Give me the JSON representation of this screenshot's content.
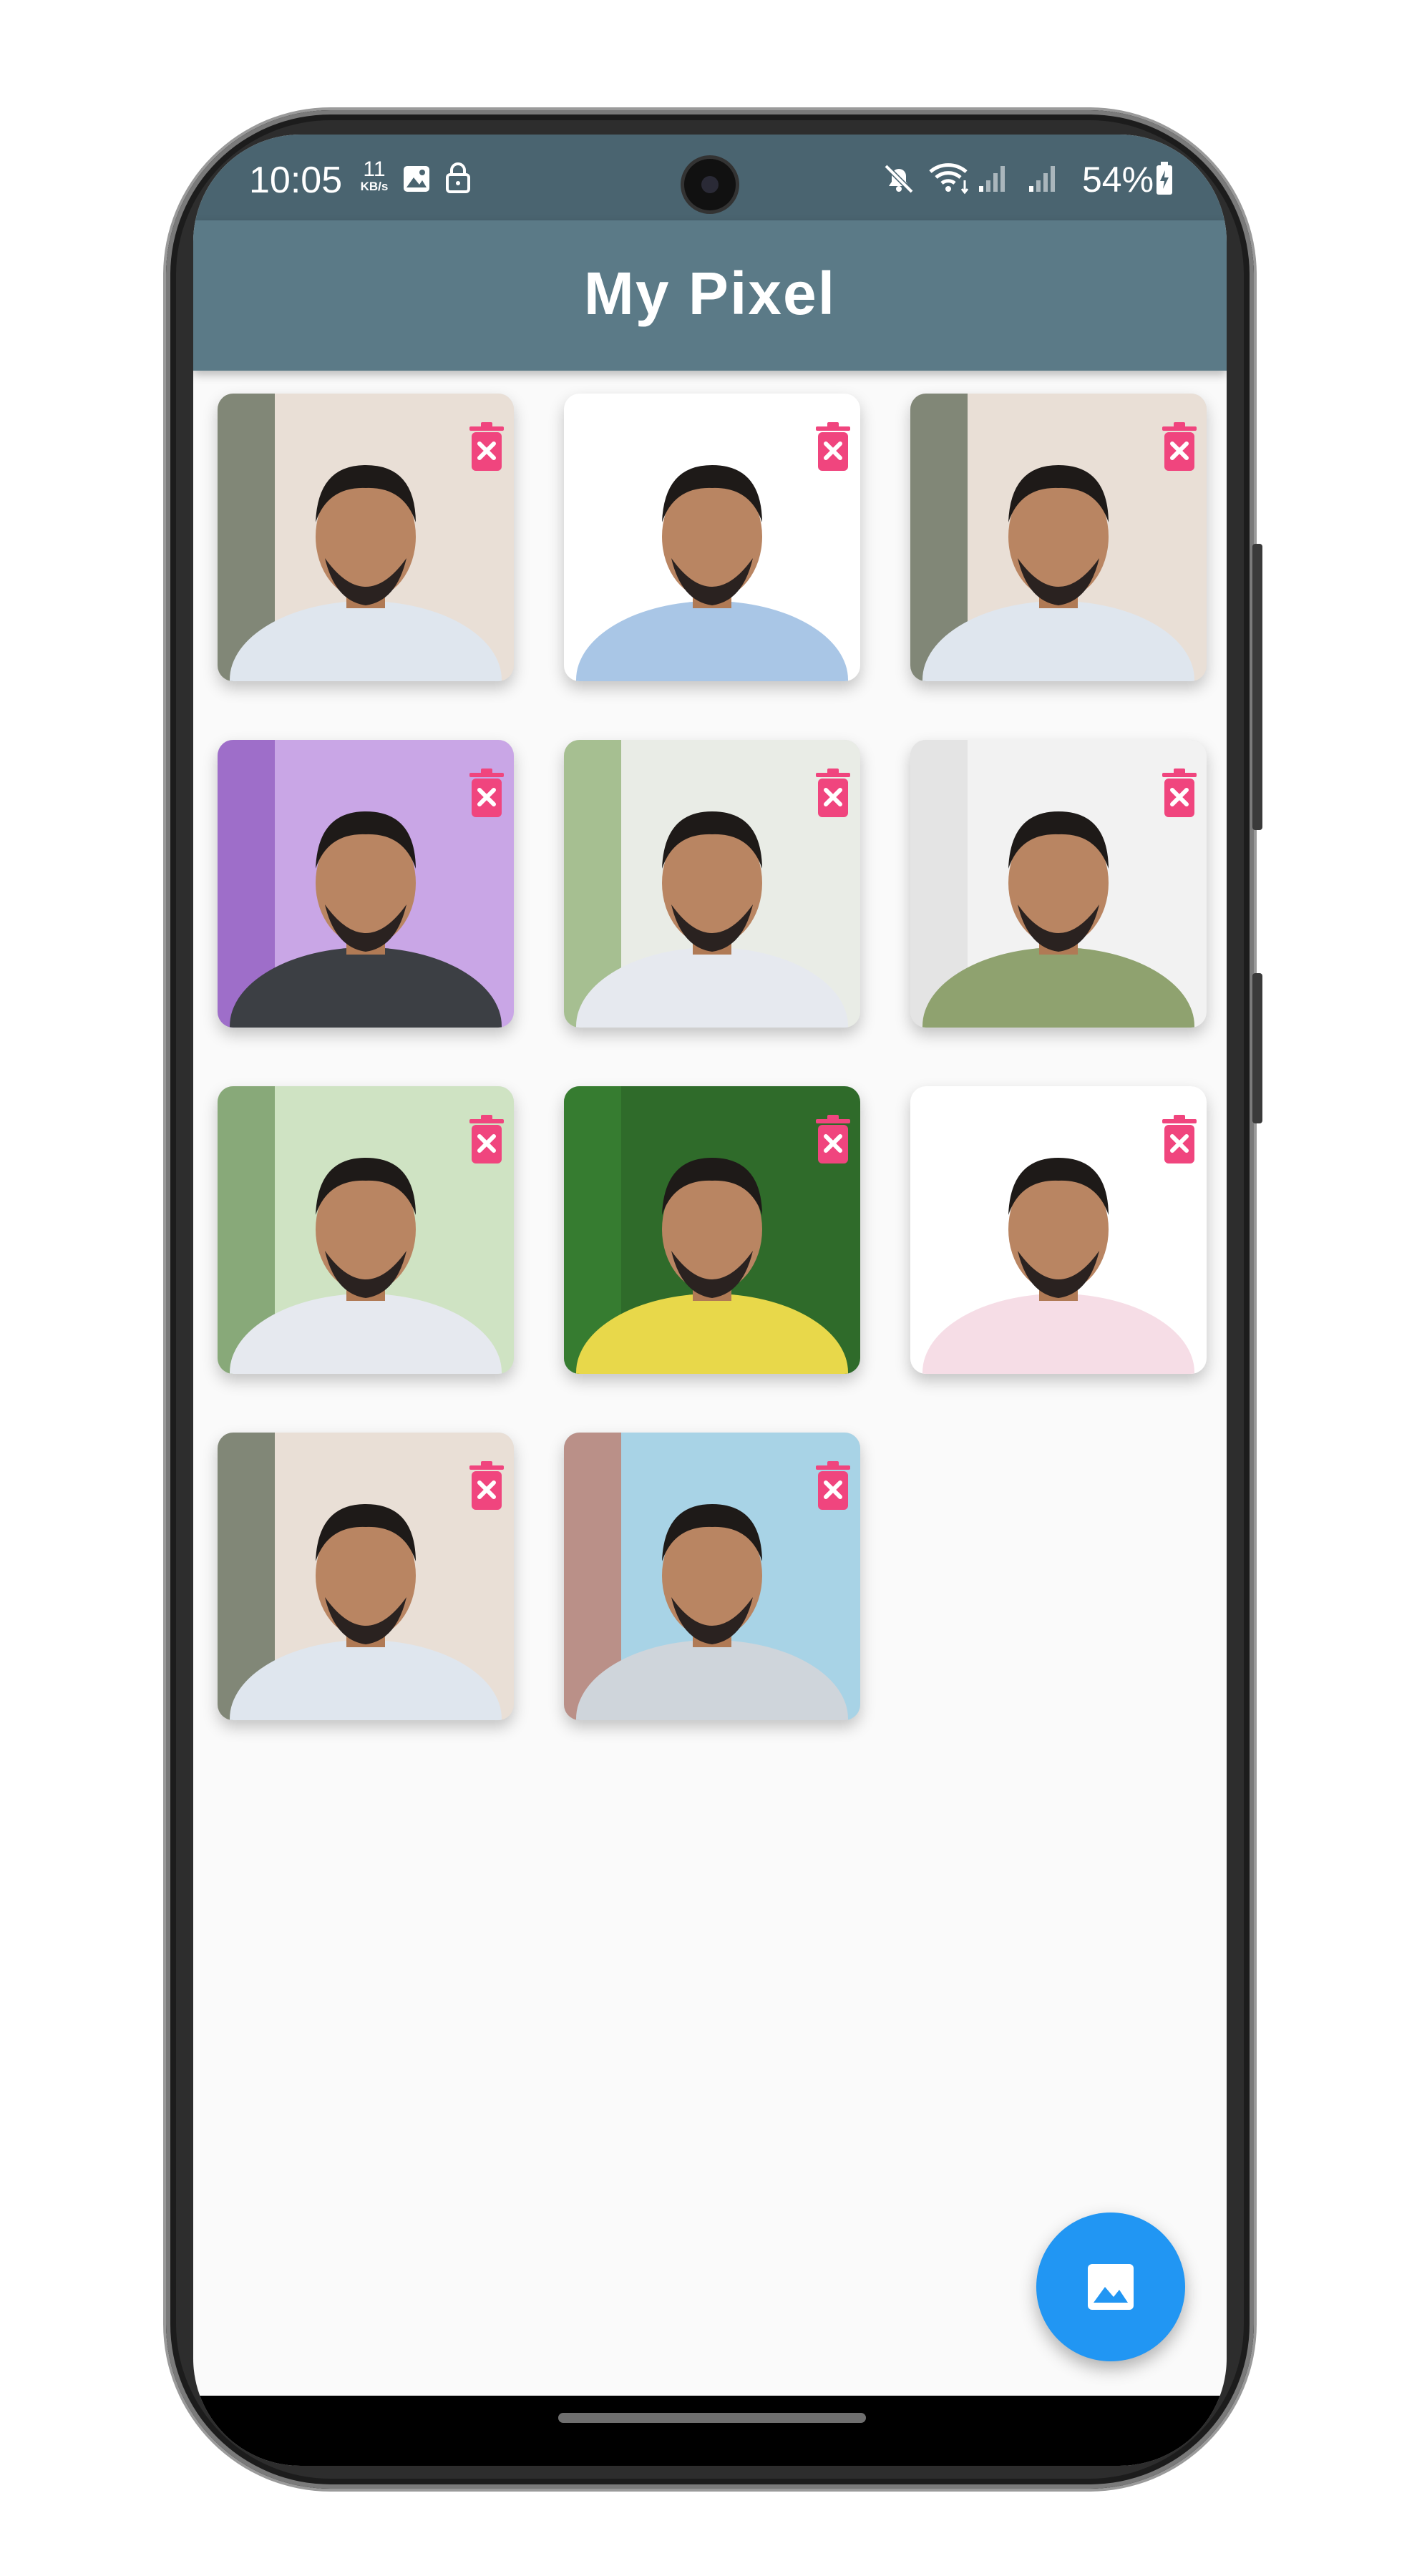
{
  "status_bar": {
    "time": "10:05",
    "net_speed_value": "11",
    "net_speed_unit": "KB/s",
    "battery_percent": "54%",
    "icons": [
      "image-icon",
      "lock-icon",
      "mute-icon",
      "wifi-icon",
      "signal-icon",
      "signal-icon",
      "battery-icon"
    ]
  },
  "app_bar": {
    "title": "My Pixel"
  },
  "gallery": {
    "photos": [
      {
        "label": "photo-1"
      },
      {
        "label": "photo-2"
      },
      {
        "label": "photo-3"
      },
      {
        "label": "photo-4"
      },
      {
        "label": "photo-5"
      },
      {
        "label": "photo-6"
      },
      {
        "label": "photo-7"
      },
      {
        "label": "photo-8"
      },
      {
        "label": "photo-9"
      },
      {
        "label": "photo-10"
      },
      {
        "label": "photo-11"
      }
    ],
    "delete_icon": "trash-icon"
  },
  "fab": {
    "icon": "image-icon"
  },
  "colors": {
    "app_bar": "#5b7a87",
    "status_bar": "#4a6470",
    "delete_accent": "#f0457e",
    "fab": "#2196f3",
    "background": "#fafafa"
  }
}
